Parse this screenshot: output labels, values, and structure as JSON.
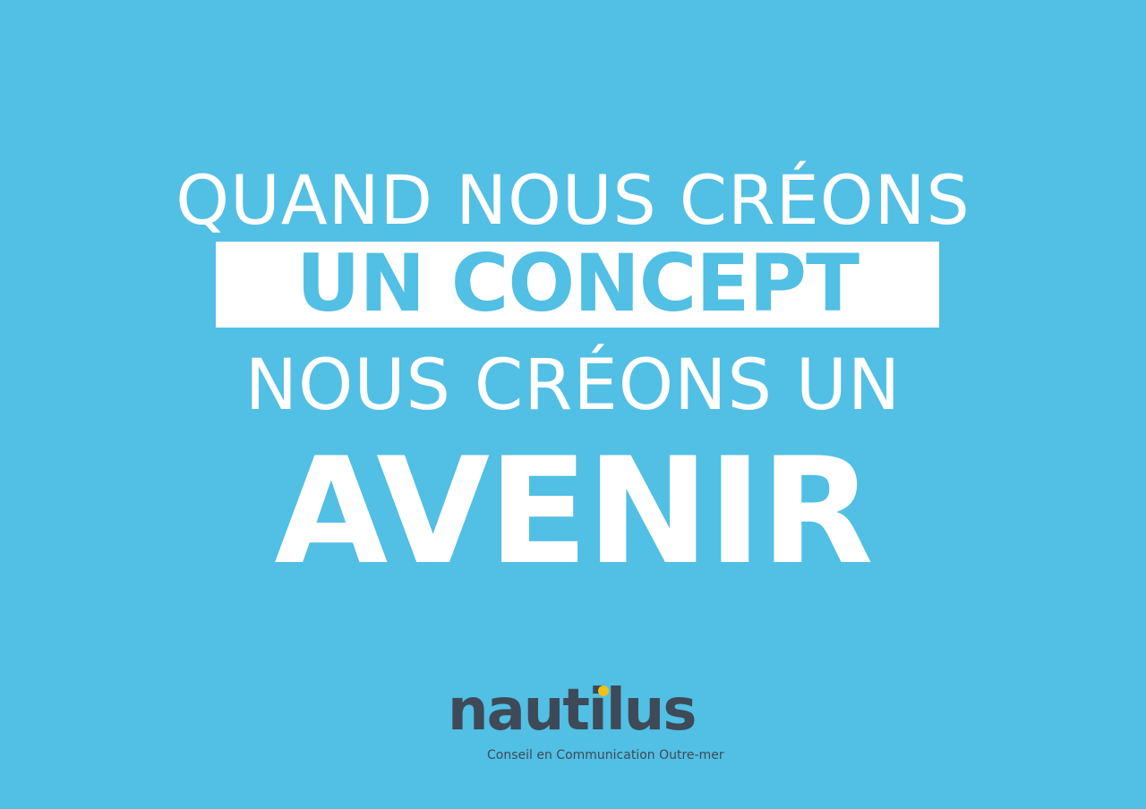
{
  "headline": {
    "line1": "QUAND NOUS CRÉONS",
    "line2": "UN CONCEPT",
    "line3": "NOUS CRÉONS UN",
    "line4": "AVENIR"
  },
  "logo": {
    "wordmark": "nautilus",
    "tagline": "Conseil en Communication Outre-mer"
  },
  "colors": {
    "background": "#52bfe4",
    "text": "#ffffff",
    "logo_text": "#3e4a57",
    "logo_accent": "#f3c018"
  }
}
